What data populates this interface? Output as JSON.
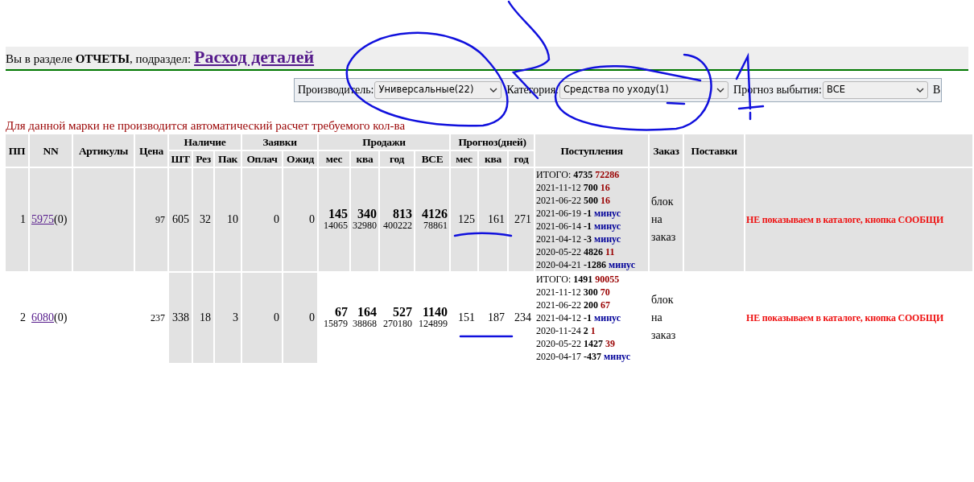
{
  "breadcrumb": {
    "prefix": "Вы в разделе ",
    "section": "ОТЧЕТЫ",
    "middle": ", подраздел: ",
    "subsection": "Расход деталей"
  },
  "filters": [
    {
      "label": "Производитель:",
      "value": "Универсальные(22)"
    },
    {
      "label": "Категория:",
      "value": "Средства по уходу(1)"
    },
    {
      "label": "Прогноз выбытия:",
      "value": "ВСЕ"
    },
    {
      "label": "В"
    }
  ],
  "warning": "Для данной марки не производится автоматический расчет требуемого кол-ва",
  "table": {
    "header_top": [
      "ПП",
      "NN",
      "Артикулы",
      "Цена",
      "Наличие",
      "Заявки",
      "Продажи",
      "Прогноз(дней)",
      "Поступления",
      "Заказ",
      "Поставки"
    ],
    "header_sub": [
      "ШТ",
      "Рез",
      "Пак",
      "Оплач",
      "Ожид",
      "мес",
      "ква",
      "год",
      "ВСЕ",
      "мес",
      "ква",
      "год"
    ],
    "rows": [
      {
        "highlighted": true,
        "pp": "1",
        "nn": "5975",
        "nn_suffix": "(0)",
        "price": "97",
        "stock": [
          "605",
          "32",
          "10"
        ],
        "orders": [
          "0",
          "0"
        ],
        "sales": [
          {
            "main": "145",
            "sub": "14065"
          },
          {
            "main": "340",
            "sub": "32980"
          },
          {
            "main": "813",
            "sub": "400222"
          },
          {
            "main": "4126",
            "sub": "78861"
          }
        ],
        "forecast": [
          "125",
          "161",
          "271"
        ],
        "arrivals_total": {
          "label": "ИТОГО:",
          "qty": "4735",
          "value": "72286"
        },
        "arrivals": [
          {
            "date": "2021-11-12",
            "qty": "700",
            "note": "16",
            "kind": "number"
          },
          {
            "date": "2021-06-22",
            "qty": "500",
            "note": "16",
            "kind": "number"
          },
          {
            "date": "2021-06-19",
            "qty": "-1",
            "note": "минус",
            "kind": "minus"
          },
          {
            "date": "2021-06-14",
            "qty": "-1",
            "note": "минус",
            "kind": "minus"
          },
          {
            "date": "2021-04-12",
            "qty": "-3",
            "note": "минус",
            "kind": "minus"
          },
          {
            "date": "2020-05-22",
            "qty": "4826",
            "note": "11",
            "kind": "number"
          },
          {
            "date": "2020-04-21",
            "qty": "-1286",
            "note": "минус",
            "kind": "minus"
          }
        ],
        "order": "блок на заказ",
        "status": "НЕ показываем в каталоге, кнопка СООБЩИ"
      },
      {
        "highlighted": false,
        "pp": "2",
        "nn": "6080",
        "nn_suffix": "(0)",
        "price": "237",
        "stock": [
          "338",
          "18",
          "3"
        ],
        "orders": [
          "0",
          "0"
        ],
        "sales": [
          {
            "main": "67",
            "sub": "15879"
          },
          {
            "main": "164",
            "sub": "38868"
          },
          {
            "main": "527",
            "sub": "270180"
          },
          {
            "main": "1140",
            "sub": "124899"
          }
        ],
        "forecast": [
          "151",
          "187",
          "234"
        ],
        "arrivals_total": {
          "label": "ИТОГО:",
          "qty": "1491",
          "value": "90055"
        },
        "arrivals": [
          {
            "date": "2021-11-12",
            "qty": "300",
            "note": "70",
            "kind": "number"
          },
          {
            "date": "2021-06-22",
            "qty": "200",
            "note": "67",
            "kind": "number"
          },
          {
            "date": "2021-04-12",
            "qty": "-1",
            "note": "минус",
            "kind": "minus"
          },
          {
            "date": "2020-11-24",
            "qty": "2",
            "note": "1",
            "kind": "number"
          },
          {
            "date": "2020-05-22",
            "qty": "1427",
            "note": "39",
            "kind": "number"
          },
          {
            "date": "2020-04-17",
            "qty": "-437",
            "note": "минус",
            "kind": "minus"
          }
        ],
        "order": "блок на заказ",
        "status": "НЕ показываем в каталоге, кнопка СООБЩИ"
      }
    ]
  }
}
